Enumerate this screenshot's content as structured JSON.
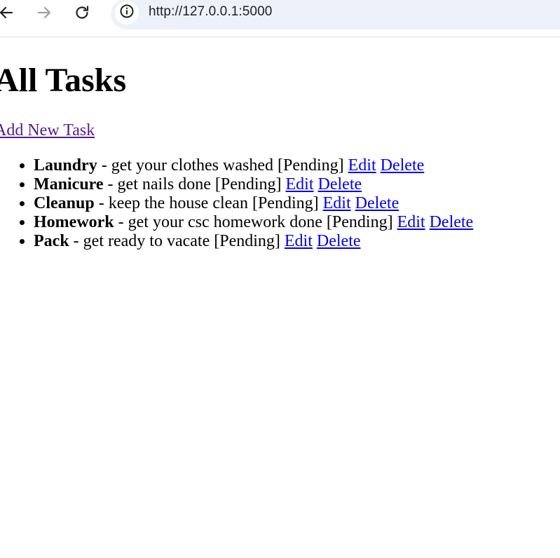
{
  "browser": {
    "url": "http://127.0.0.1:5000",
    "icons": {
      "back": "back-arrow-icon",
      "forward": "forward-arrow-icon",
      "reload": "reload-icon",
      "site_info": "info-icon"
    },
    "colors": {
      "omnibox_bg": "#edf2fa"
    }
  },
  "page": {
    "title": "All Tasks",
    "add_link": "Add New Task",
    "link_colors": {
      "visited": "#551a8b",
      "unvisited": "#0000ee"
    },
    "tasks": [
      {
        "name": "Laundry",
        "sep": " - ",
        "description": "get your clothes washed",
        "status": "[Pending]",
        "edit": "Edit",
        "delete": "Delete"
      },
      {
        "name": "Manicure",
        "sep": " - ",
        "description": "get nails done",
        "status": "[Pending]",
        "edit": "Edit",
        "delete": "Delete"
      },
      {
        "name": "Cleanup",
        "sep": " - ",
        "description": "keep the house clean",
        "status": "[Pending]",
        "edit": "Edit",
        "delete": "Delete"
      },
      {
        "name": "Homework",
        "sep": " - ",
        "description": "get your csc homework done",
        "status": "[Pending]",
        "edit": "Edit",
        "delete": "Delete"
      },
      {
        "name": "Pack",
        "sep": " - ",
        "description": "get ready to vacate",
        "status": "[Pending]",
        "edit": "Edit",
        "delete": "Delete"
      }
    ]
  }
}
